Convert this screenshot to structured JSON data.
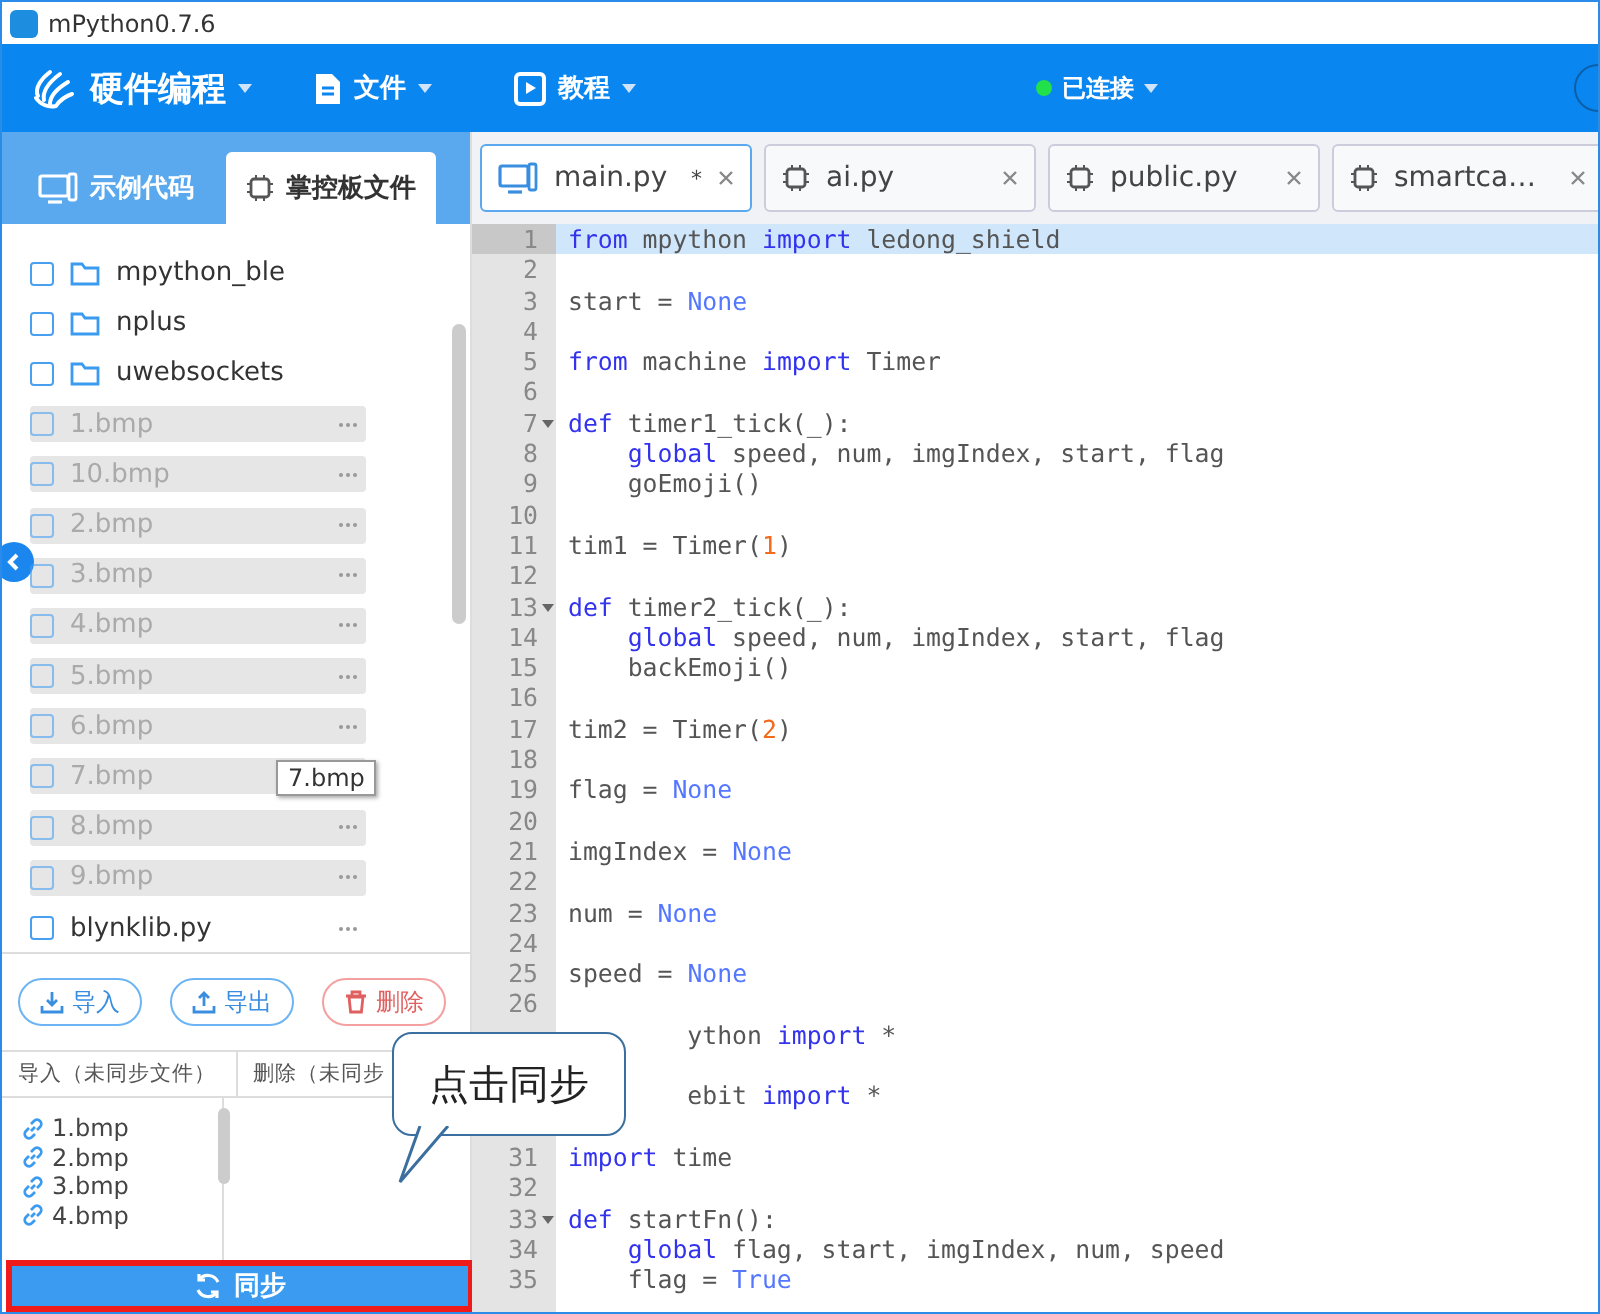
{
  "window": {
    "title": "mPython0.7.6"
  },
  "menu": [
    {
      "kind": "brand",
      "label": "硬件编程"
    },
    {
      "kind": "file",
      "label": "文件"
    },
    {
      "kind": "tutorial",
      "label": "教程"
    }
  ],
  "connection": {
    "label": "已连接",
    "connected": true
  },
  "sidebar_tabs": [
    {
      "label": "示例代码",
      "kind": "examples",
      "selected": false
    },
    {
      "label": "掌控板文件",
      "kind": "board",
      "selected": true
    }
  ],
  "files": [
    {
      "kind": "folder",
      "name": "mpython_ble",
      "checked": false,
      "disabled": false
    },
    {
      "kind": "folder",
      "name": "nplus",
      "checked": false,
      "disabled": false
    },
    {
      "kind": "folder",
      "name": "uwebsockets",
      "checked": false,
      "disabled": false
    },
    {
      "kind": "file",
      "name": "1.bmp",
      "checked": false,
      "disabled": true
    },
    {
      "kind": "file",
      "name": "10.bmp",
      "checked": false,
      "disabled": true
    },
    {
      "kind": "file",
      "name": "2.bmp",
      "checked": false,
      "disabled": true
    },
    {
      "kind": "file",
      "name": "3.bmp",
      "checked": false,
      "disabled": true
    },
    {
      "kind": "file",
      "name": "4.bmp",
      "checked": false,
      "disabled": true
    },
    {
      "kind": "file",
      "name": "5.bmp",
      "checked": false,
      "disabled": true
    },
    {
      "kind": "file",
      "name": "6.bmp",
      "checked": false,
      "disabled": true
    },
    {
      "kind": "file",
      "name": "7.bmp",
      "checked": false,
      "disabled": true,
      "tooltip": "7.bmp"
    },
    {
      "kind": "file",
      "name": "8.bmp",
      "checked": false,
      "disabled": true
    },
    {
      "kind": "file",
      "name": "9.bmp",
      "checked": false,
      "disabled": true
    },
    {
      "kind": "file",
      "name": "blynklib.py",
      "checked": false,
      "disabled": false
    }
  ],
  "file_actions": [
    {
      "kind": "import",
      "label": "导入"
    },
    {
      "kind": "export",
      "label": "导出"
    },
    {
      "kind": "delete",
      "label": "删除"
    }
  ],
  "sync_panel": {
    "columns": [
      "导入（未同步文件）",
      "删除（未同步"
    ],
    "pending": [
      "1.bmp",
      "2.bmp",
      "3.bmp",
      "4.bmp"
    ],
    "button": "同步"
  },
  "callout": {
    "text": "点击同步"
  },
  "editor_tabs": [
    {
      "label": "main.py",
      "kind": "local",
      "marker": "*",
      "selected": true
    },
    {
      "label": "ai.py",
      "kind": "board",
      "selected": false
    },
    {
      "label": "public.py",
      "kind": "board",
      "selected": false
    },
    {
      "label": "smartca…",
      "kind": "board",
      "selected": false
    }
  ],
  "code": [
    {
      "n": "1",
      "segments": [
        {
          "kind": "keyword",
          "text": "from"
        },
        {
          "kind": "plain",
          "text": " mpython "
        },
        {
          "kind": "keyword",
          "text": "import"
        },
        {
          "kind": "plain",
          "text": " ledong_shield"
        }
      ]
    },
    {
      "n": "2"
    },
    {
      "n": "3",
      "segments": [
        {
          "kind": "plain",
          "text": "start = "
        },
        {
          "kind": "constant",
          "text": "None"
        }
      ]
    },
    {
      "n": "4"
    },
    {
      "n": "5",
      "segments": [
        {
          "kind": "keyword",
          "text": "from"
        },
        {
          "kind": "plain",
          "text": " machine "
        },
        {
          "kind": "keyword",
          "text": "import"
        },
        {
          "kind": "plain",
          "text": " Timer"
        }
      ]
    },
    {
      "n": "6"
    },
    {
      "n": "7",
      "fold": true,
      "segments": [
        {
          "kind": "keyword",
          "text": "def"
        },
        {
          "kind": "plain",
          "text": " timer1_tick(_):"
        }
      ]
    },
    {
      "n": "8",
      "indented": true,
      "segments": [
        {
          "kind": "keyword",
          "text": "global"
        },
        {
          "kind": "plain",
          "text": " speed, num, imgIndex, start, flag"
        }
      ]
    },
    {
      "n": "9",
      "indented": true,
      "segments": [
        {
          "kind": "plain",
          "text": "goEmoji()"
        }
      ]
    },
    {
      "n": "10"
    },
    {
      "n": "11",
      "segments": [
        {
          "kind": "plain",
          "text": "tim1 = Timer("
        },
        {
          "kind": "number",
          "text": "1"
        },
        {
          "kind": "plain",
          "text": ")"
        }
      ]
    },
    {
      "n": "12"
    },
    {
      "n": "13",
      "fold": true,
      "segments": [
        {
          "kind": "keyword",
          "text": "def"
        },
        {
          "kind": "plain",
          "text": " timer2_tick(_):"
        }
      ]
    },
    {
      "n": "14",
      "indented": true,
      "segments": [
        {
          "kind": "keyword",
          "text": "global"
        },
        {
          "kind": "plain",
          "text": " speed, num, imgIndex, start, flag"
        }
      ]
    },
    {
      "n": "15",
      "indented": true,
      "segments": [
        {
          "kind": "plain",
          "text": "backEmoji()"
        }
      ]
    },
    {
      "n": "16"
    },
    {
      "n": "17",
      "segments": [
        {
          "kind": "plain",
          "text": "tim2 = Timer("
        },
        {
          "kind": "number",
          "text": "2"
        },
        {
          "kind": "plain",
          "text": ")"
        }
      ]
    },
    {
      "n": "18"
    },
    {
      "n": "19",
      "segments": [
        {
          "kind": "plain",
          "text": "flag = "
        },
        {
          "kind": "constant",
          "text": "None"
        }
      ]
    },
    {
      "n": "20"
    },
    {
      "n": "21",
      "segments": [
        {
          "kind": "plain",
          "text": "imgIndex = "
        },
        {
          "kind": "constant",
          "text": "None"
        }
      ]
    },
    {
      "n": "22"
    },
    {
      "n": "23",
      "segments": [
        {
          "kind": "plain",
          "text": "num = "
        },
        {
          "kind": "constant",
          "text": "None"
        }
      ]
    },
    {
      "n": "24"
    },
    {
      "n": "25",
      "segments": [
        {
          "kind": "plain",
          "text": "speed = "
        },
        {
          "kind": "constant",
          "text": "None"
        }
      ]
    },
    {
      "n": "26"
    },
    {
      "covered": true,
      "segments": [
        {
          "kind": "plain",
          "text": "ython "
        },
        {
          "kind": "keyword",
          "text": "import"
        },
        {
          "kind": "plain",
          "text": " *"
        }
      ]
    },
    {
      "covered": true
    },
    {
      "covered": true,
      "segments": [
        {
          "kind": "plain",
          "text": "ebit "
        },
        {
          "kind": "keyword",
          "text": "import"
        },
        {
          "kind": "plain",
          "text": " *"
        }
      ]
    },
    {
      "covered": true
    },
    {
      "n": "31",
      "segments": [
        {
          "kind": "keyword",
          "text": "import"
        },
        {
          "kind": "plain",
          "text": " time"
        }
      ]
    },
    {
      "n": "32"
    },
    {
      "n": "33",
      "fold": true,
      "segments": [
        {
          "kind": "keyword",
          "text": "def"
        },
        {
          "kind": "plain",
          "text": " startFn():"
        }
      ]
    },
    {
      "n": "34",
      "indented": true,
      "segments": [
        {
          "kind": "keyword",
          "text": "global"
        },
        {
          "kind": "plain",
          "text": " flag, start, imgIndex, num, speed"
        }
      ]
    },
    {
      "n": "35",
      "indented": true,
      "segments": [
        {
          "kind": "plain",
          "text": "flag = "
        },
        {
          "kind": "constant",
          "text": "True"
        }
      ]
    }
  ]
}
